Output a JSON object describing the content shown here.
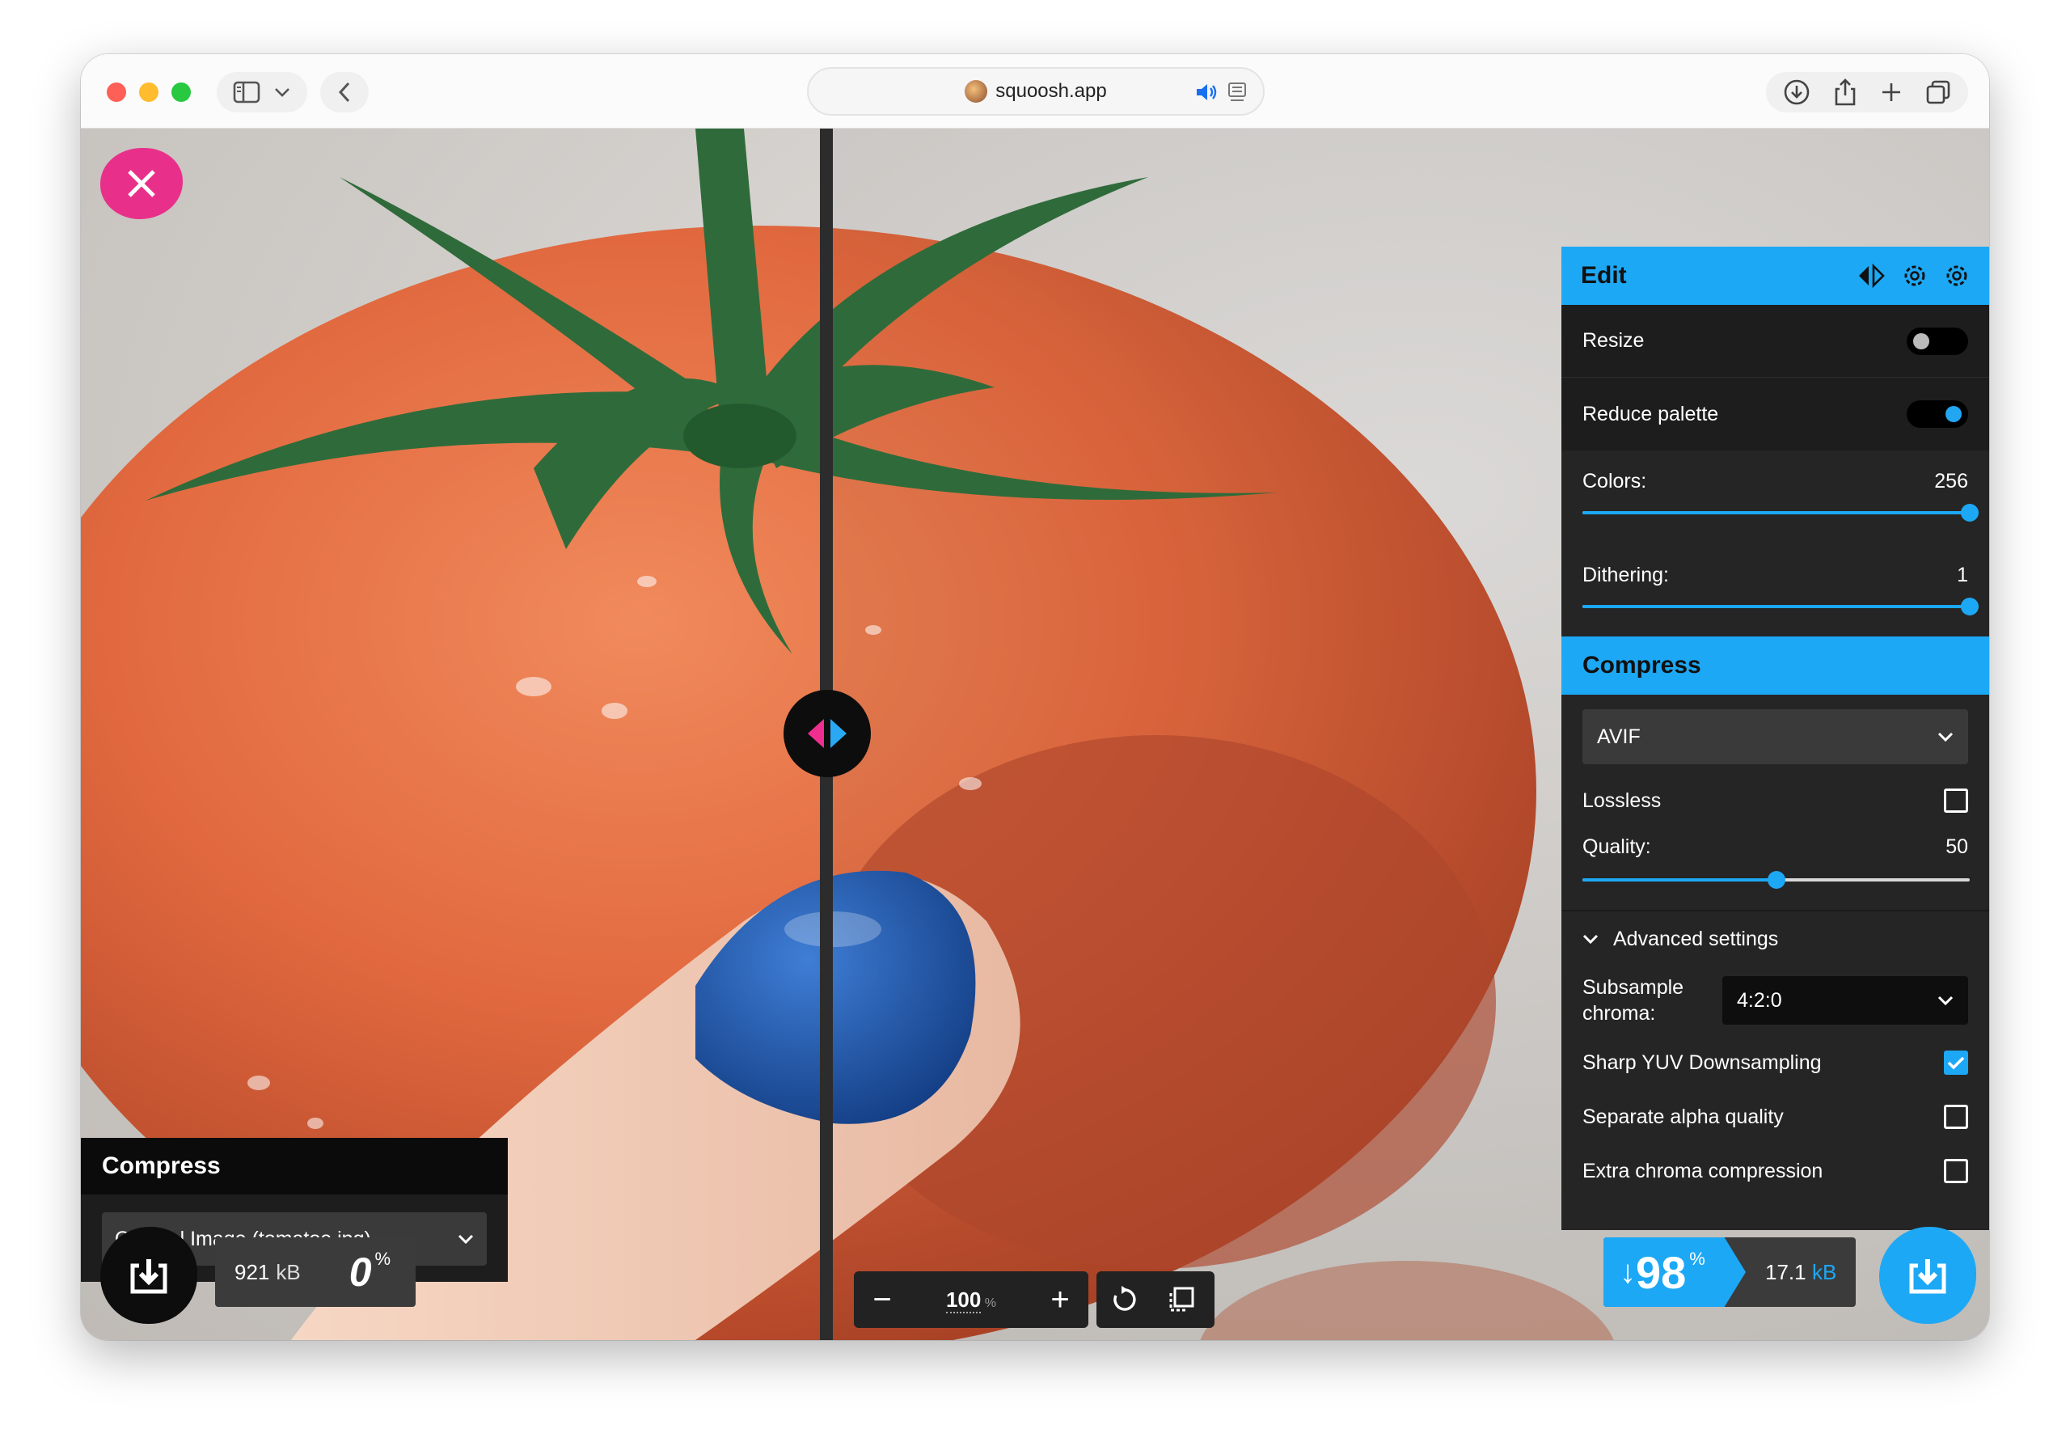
{
  "browser": {
    "url": "squoosh.app",
    "icons": [
      "sidebar-icon",
      "chevron-down-icon",
      "back-icon",
      "speaker-icon",
      "reader-icon",
      "download-icon",
      "share-icon",
      "plus-icon",
      "tabs-icon"
    ]
  },
  "app": {
    "colors": {
      "accent": "#1da8f5",
      "close": "#e8308a",
      "panel": "#252525"
    },
    "edit": {
      "title": "Edit",
      "resize_label": "Resize",
      "resize_on": false,
      "reduce_palette_label": "Reduce palette",
      "reduce_palette_on": true,
      "colors_label": "Colors:",
      "colors_value": "256",
      "colors_fraction": 1.0,
      "dithering_label": "Dithering:",
      "dithering_value": "1",
      "dithering_fraction": 1.0
    },
    "compress": {
      "title": "Compress",
      "codec": "AVIF",
      "lossless_label": "Lossless",
      "lossless_checked": false,
      "quality_label": "Quality:",
      "quality_value": "50",
      "quality_fraction": 0.5,
      "advanced_label": "Advanced settings",
      "subsample_label_1": "Subsample",
      "subsample_label_2": "chroma:",
      "subsample_value": "4:2:0",
      "sharp_yuv_label": "Sharp YUV Downsampling",
      "sharp_yuv_checked": true,
      "separate_alpha_label": "Separate alpha quality",
      "separate_alpha_checked": false,
      "extra_chroma_label": "Extra chroma compression",
      "extra_chroma_checked": false
    },
    "left": {
      "title": "Compress",
      "source": "Original Image (tomatoe.jpg)",
      "size_value": "921",
      "size_unit": "kB",
      "percent_value": "0",
      "percent_sign": "%"
    },
    "right_stats": {
      "arrow": "↓",
      "percent_value": "98",
      "percent_sign": "%",
      "size_value": "17.1",
      "size_unit": "kB"
    },
    "zoom": {
      "value": "100",
      "unit": "%",
      "minus": "−",
      "plus": "+"
    }
  }
}
